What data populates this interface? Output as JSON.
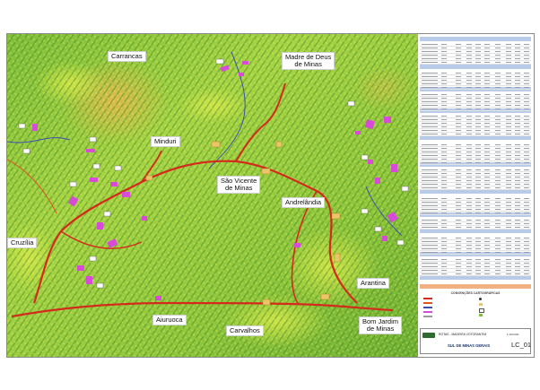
{
  "map": {
    "cities": [
      {
        "id": "carrancas",
        "label": "Carrancas"
      },
      {
        "id": "madre-de-deus",
        "label": "Madre de Deus\nde Minas"
      },
      {
        "id": "minduri",
        "label": "Minduri"
      },
      {
        "id": "sao-vicente",
        "label": "São Vicente\nde Minas"
      },
      {
        "id": "andrelandia",
        "label": "Andrelândia"
      },
      {
        "id": "cruzilia",
        "label": "Cruzília"
      },
      {
        "id": "arantina",
        "label": "Arantina"
      },
      {
        "id": "aiuruoca",
        "label": "Aiuruoca"
      },
      {
        "id": "carvalhos",
        "label": "Carvalhos"
      },
      {
        "id": "bom-jardim",
        "label": "Bom Jardim\nde Minas"
      }
    ],
    "colors": {
      "terrain_light": "#d7e84a",
      "terrain_mid": "#8fc43a",
      "terrain_dark": "#3f8f2e",
      "highland": "#e0b64a",
      "route": "#d42a1c",
      "road": "#e0531e",
      "river": "#3a4fb0",
      "parcel": "#d84ad8"
    }
  },
  "panel": {
    "section_colors": {
      "header": "#b8cbe8",
      "total": "#f2b183"
    }
  },
  "legend": {
    "title": "CONVENÇÕES CARTOGRÁFICAS"
  },
  "title_block": {
    "project": "ROTAS - MADEIRA VOTORANTIM",
    "scale": "1:100.000",
    "region": "SUL DE MINAS GERAIS",
    "sheet": "LC_01"
  }
}
